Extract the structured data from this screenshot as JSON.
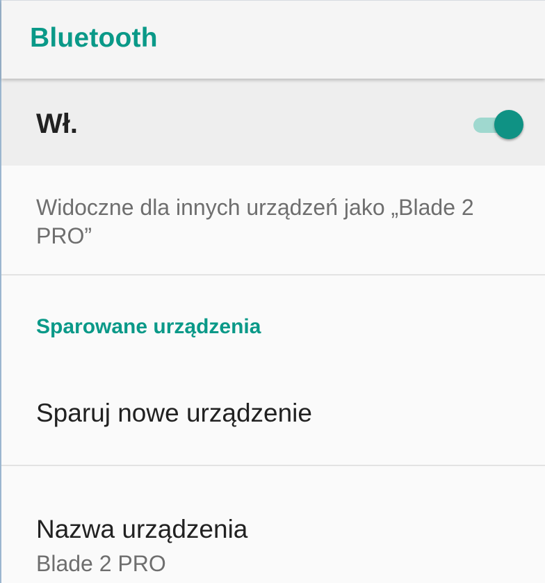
{
  "toolbar": {
    "title": "Bluetooth"
  },
  "master_switch": {
    "label": "Wł.",
    "state": "on",
    "accent_color": "#0f9284"
  },
  "visibility": {
    "text": "Widoczne dla innych urządzeń jako „Blade 2 PRO”"
  },
  "paired_devices": {
    "header": "Sparowane urządzenia"
  },
  "pair_new_device": {
    "label": "Sparuj nowe urządzenie"
  },
  "device_name": {
    "title": "Nazwa urządzenia",
    "value": "Blade 2 PRO"
  },
  "colors": {
    "accent": "#0a9988",
    "toolbar_bg": "#f5f5f5",
    "switch_row_bg": "#eeeeee",
    "page_bg": "#fafafa"
  }
}
